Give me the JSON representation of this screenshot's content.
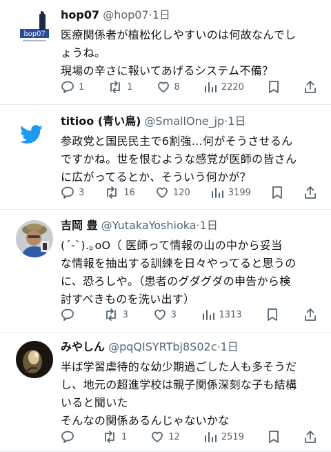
{
  "tweets": [
    {
      "display_name": "hop07",
      "handle": "@hop07",
      "time": "1日",
      "avatar_label": "hop07",
      "lines": [
        "医療関係者が植松化しやすいのは何故なんでし",
        "ょうね。",
        "現場の辛さに報いてあげるシステム不備？"
      ],
      "replies": "1",
      "retweets": "1",
      "likes": "8",
      "views": "2220"
    },
    {
      "display_name": "titioo (青い鳥)",
      "handle": "@SmallOne_jp",
      "time": "1日",
      "lines": [
        "参政党と国民民主で6割強…何がそうさせるん",
        "ですかね。世を恨むような感覚が医師の皆さん",
        "に広がってるとか、そういう何かが？"
      ],
      "replies": "3",
      "retweets": "16",
      "likes": "120",
      "views": "3199"
    },
    {
      "display_name": "吉岡 豊",
      "handle": "@YutakaYoshioka",
      "time": "1日",
      "lines": [
        "(´-`).｡oO（ 医師って情報の山の中から妥当",
        "な情報を抽出する訓練を日々やってると思うの",
        "に、恐ろしや。（患者のグダグダの申告から検",
        "討すべきものを洗い出す）"
      ],
      "replies": "",
      "retweets": "3",
      "likes": "3",
      "views": "1313"
    },
    {
      "display_name": "みやしん",
      "handle": "@pqQISYRTbj8S02c",
      "time": "1日",
      "lines": [
        "半ば学習虐待的な幼少期過ごした人も多そうだ",
        "し、地元の超進学校は親子関係深刻な子も結構",
        "いると聞いた",
        "そんなの関係あるんじゃないかな"
      ],
      "replies": "",
      "retweets": "1",
      "likes": "12",
      "views": "2519"
    }
  ],
  "separator": "·",
  "icons": [
    "reply-icon",
    "retweet-icon",
    "like-icon",
    "views-icon",
    "bookmark-icon",
    "share-icon"
  ],
  "colors": {
    "text": "#0f1419",
    "secondary": "#536471",
    "divider": "#e6ecf0",
    "twitter_blue": "#1d9bf0"
  }
}
